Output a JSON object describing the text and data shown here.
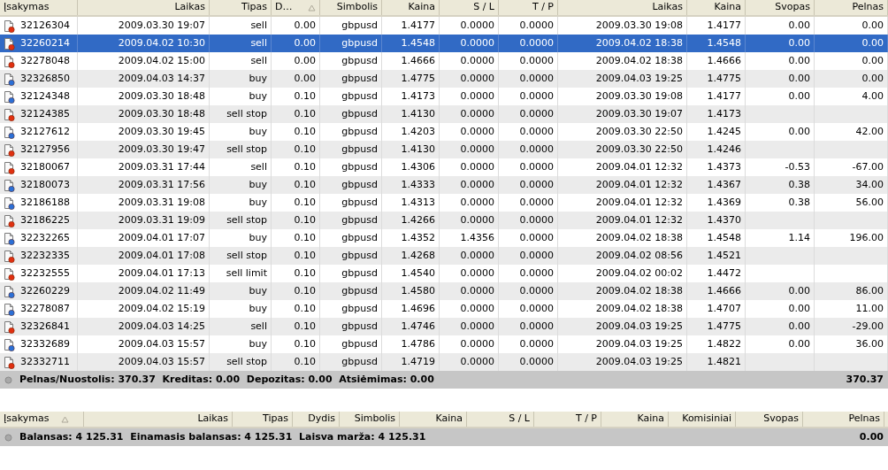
{
  "history": {
    "columns": [
      {
        "label": "Įsakymas",
        "sorted": false
      },
      {
        "label": "Laikas",
        "sorted": false
      },
      {
        "label": "Tipas",
        "sorted": false
      },
      {
        "label": "D…",
        "sorted": true
      },
      {
        "label": "Simbolis",
        "sorted": false
      },
      {
        "label": "Kaina",
        "sorted": false
      },
      {
        "label": "S / L",
        "sorted": false
      },
      {
        "label": "T / P",
        "sorted": false
      },
      {
        "label": "Laikas",
        "sorted": false
      },
      {
        "label": "Kaina",
        "sorted": false
      },
      {
        "label": "Svopas",
        "sorted": false
      },
      {
        "label": "Pelnas",
        "sorted": false
      }
    ],
    "rows": [
      {
        "kind": "sell",
        "selected": false,
        "cells": [
          "32126304",
          "2009.03.30 19:07",
          "sell",
          "0.00",
          "gbpusd",
          "1.4177",
          "0.0000",
          "0.0000",
          "2009.03.30 19:08",
          "1.4177",
          "0.00",
          "0.00"
        ]
      },
      {
        "kind": "sell",
        "selected": true,
        "cells": [
          "32260214",
          "2009.04.02 10:30",
          "sell",
          "0.00",
          "gbpusd",
          "1.4548",
          "0.0000",
          "0.0000",
          "2009.04.02 18:38",
          "1.4548",
          "0.00",
          "0.00"
        ]
      },
      {
        "kind": "sell",
        "selected": false,
        "cells": [
          "32278048",
          "2009.04.02 15:00",
          "sell",
          "0.00",
          "gbpusd",
          "1.4666",
          "0.0000",
          "0.0000",
          "2009.04.02 18:38",
          "1.4666",
          "0.00",
          "0.00"
        ]
      },
      {
        "kind": "buy",
        "selected": false,
        "cells": [
          "32326850",
          "2009.04.03 14:37",
          "buy",
          "0.00",
          "gbpusd",
          "1.4775",
          "0.0000",
          "0.0000",
          "2009.04.03 19:25",
          "1.4775",
          "0.00",
          "0.00"
        ]
      },
      {
        "kind": "buy",
        "selected": false,
        "cells": [
          "32124348",
          "2009.03.30 18:48",
          "buy",
          "0.10",
          "gbpusd",
          "1.4173",
          "0.0000",
          "0.0000",
          "2009.03.30 19:08",
          "1.4177",
          "0.00",
          "4.00"
        ]
      },
      {
        "kind": "sell",
        "selected": false,
        "cells": [
          "32124385",
          "2009.03.30 18:48",
          "sell stop",
          "0.10",
          "gbpusd",
          "1.4130",
          "0.0000",
          "0.0000",
          "2009.03.30 19:07",
          "1.4173",
          "",
          ""
        ]
      },
      {
        "kind": "buy",
        "selected": false,
        "cells": [
          "32127612",
          "2009.03.30 19:45",
          "buy",
          "0.10",
          "gbpusd",
          "1.4203",
          "0.0000",
          "0.0000",
          "2009.03.30 22:50",
          "1.4245",
          "0.00",
          "42.00"
        ]
      },
      {
        "kind": "sell",
        "selected": false,
        "cells": [
          "32127956",
          "2009.03.30 19:47",
          "sell stop",
          "0.10",
          "gbpusd",
          "1.4130",
          "0.0000",
          "0.0000",
          "2009.03.30 22:50",
          "1.4246",
          "",
          ""
        ]
      },
      {
        "kind": "sell",
        "selected": false,
        "cells": [
          "32180067",
          "2009.03.31 17:44",
          "sell",
          "0.10",
          "gbpusd",
          "1.4306",
          "0.0000",
          "0.0000",
          "2009.04.01 12:32",
          "1.4373",
          "-0.53",
          "-67.00"
        ]
      },
      {
        "kind": "buy",
        "selected": false,
        "cells": [
          "32180073",
          "2009.03.31 17:56",
          "buy",
          "0.10",
          "gbpusd",
          "1.4333",
          "0.0000",
          "0.0000",
          "2009.04.01 12:32",
          "1.4367",
          "0.38",
          "34.00"
        ]
      },
      {
        "kind": "buy",
        "selected": false,
        "cells": [
          "32186188",
          "2009.03.31 19:08",
          "buy",
          "0.10",
          "gbpusd",
          "1.4313",
          "0.0000",
          "0.0000",
          "2009.04.01 12:32",
          "1.4369",
          "0.38",
          "56.00"
        ]
      },
      {
        "kind": "sell",
        "selected": false,
        "cells": [
          "32186225",
          "2009.03.31 19:09",
          "sell stop",
          "0.10",
          "gbpusd",
          "1.4266",
          "0.0000",
          "0.0000",
          "2009.04.01 12:32",
          "1.4370",
          "",
          ""
        ]
      },
      {
        "kind": "buy",
        "selected": false,
        "cells": [
          "32232265",
          "2009.04.01 17:07",
          "buy",
          "0.10",
          "gbpusd",
          "1.4352",
          "1.4356",
          "0.0000",
          "2009.04.02 18:38",
          "1.4548",
          "1.14",
          "196.00"
        ]
      },
      {
        "kind": "sell",
        "selected": false,
        "cells": [
          "32232335",
          "2009.04.01 17:08",
          "sell stop",
          "0.10",
          "gbpusd",
          "1.4268",
          "0.0000",
          "0.0000",
          "2009.04.02 08:56",
          "1.4521",
          "",
          ""
        ]
      },
      {
        "kind": "sell",
        "selected": false,
        "cells": [
          "32232555",
          "2009.04.01 17:13",
          "sell limit",
          "0.10",
          "gbpusd",
          "1.4540",
          "0.0000",
          "0.0000",
          "2009.04.02 00:02",
          "1.4472",
          "",
          ""
        ]
      },
      {
        "kind": "buy",
        "selected": false,
        "cells": [
          "32260229",
          "2009.04.02 11:49",
          "buy",
          "0.10",
          "gbpusd",
          "1.4580",
          "0.0000",
          "0.0000",
          "2009.04.02 18:38",
          "1.4666",
          "0.00",
          "86.00"
        ]
      },
      {
        "kind": "buy",
        "selected": false,
        "cells": [
          "32278087",
          "2009.04.02 15:19",
          "buy",
          "0.10",
          "gbpusd",
          "1.4696",
          "0.0000",
          "0.0000",
          "2009.04.02 18:38",
          "1.4707",
          "0.00",
          "11.00"
        ]
      },
      {
        "kind": "sell",
        "selected": false,
        "cells": [
          "32326841",
          "2009.04.03 14:25",
          "sell",
          "0.10",
          "gbpusd",
          "1.4746",
          "0.0000",
          "0.0000",
          "2009.04.03 19:25",
          "1.4775",
          "0.00",
          "-29.00"
        ]
      },
      {
        "kind": "buy",
        "selected": false,
        "cells": [
          "32332689",
          "2009.04.03 15:57",
          "buy",
          "0.10",
          "gbpusd",
          "1.4786",
          "0.0000",
          "0.0000",
          "2009.04.03 19:25",
          "1.4822",
          "0.00",
          "36.00"
        ]
      },
      {
        "kind": "sell",
        "selected": false,
        "cells": [
          "32332711",
          "2009.04.03 15:57",
          "sell stop",
          "0.10",
          "gbpusd",
          "1.4719",
          "0.0000",
          "0.0000",
          "2009.04.03 19:25",
          "1.4821",
          "",
          ""
        ]
      }
    ],
    "summary": {
      "text": "Pelnas/Nuostolis: 370.37  Kreditas: 0.00  Depozitas: 0.00  Atsiėmimas: 0.00",
      "total": "370.37"
    }
  },
  "trade": {
    "columns": [
      {
        "label": "Įsakymas",
        "sorted": true
      },
      {
        "label": "Laikas",
        "sorted": false
      },
      {
        "label": "Tipas",
        "sorted": false
      },
      {
        "label": "Dydis",
        "sorted": false
      },
      {
        "label": "Simbolis",
        "sorted": false
      },
      {
        "label": "Kaina",
        "sorted": false
      },
      {
        "label": "S / L",
        "sorted": false
      },
      {
        "label": "T / P",
        "sorted": false
      },
      {
        "label": "Kaina",
        "sorted": false
      },
      {
        "label": "Komisiniai",
        "sorted": false
      },
      {
        "label": "Svopas",
        "sorted": false
      },
      {
        "label": "Pelnas",
        "sorted": false
      }
    ],
    "summary": {
      "text": "Balansas: 4 125.31  Einamasis balansas: 4 125.31  Laisva marža: 4 125.31",
      "total": "0.00"
    }
  }
}
